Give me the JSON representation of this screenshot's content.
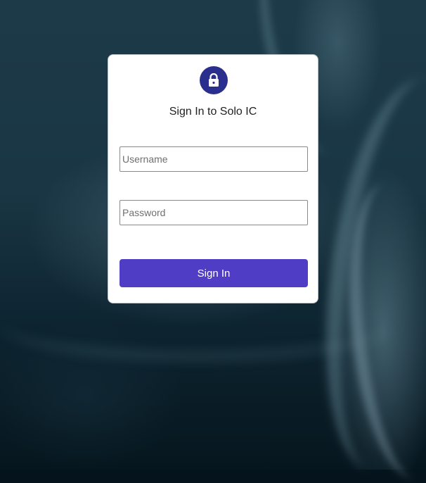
{
  "login": {
    "title": "Sign In to Solo IC",
    "username_placeholder": "Username",
    "username_value": "",
    "password_placeholder": "Password",
    "password_value": "",
    "submit_label": "Sign In"
  },
  "icons": {
    "badge": "lock-icon"
  },
  "colors": {
    "badge_bg": "#2a2f8e",
    "button_bg": "#4f3dc6",
    "card_bg": "#ffffff",
    "background": "#1a3644"
  }
}
